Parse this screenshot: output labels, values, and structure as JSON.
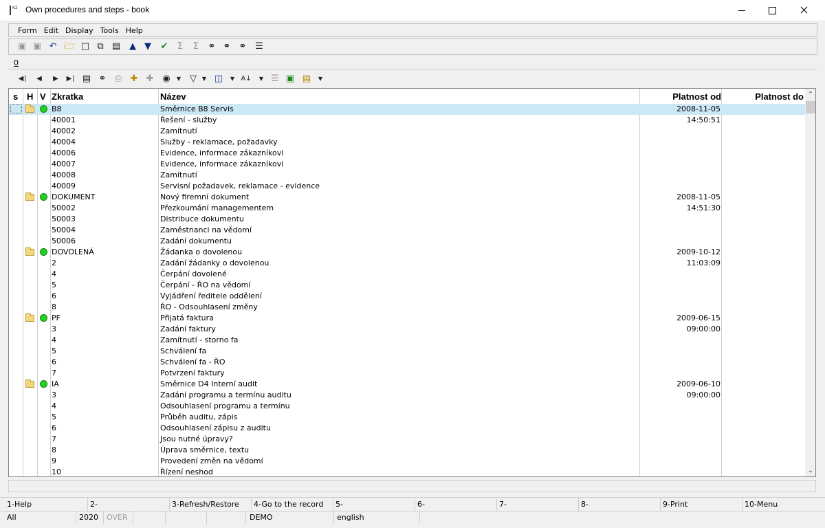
{
  "window": {
    "title": "Own procedures and steps - book",
    "app_icon_text": "K2"
  },
  "menu": [
    "Form",
    "Edit",
    "Display",
    "Tools",
    "Help"
  ],
  "tab": {
    "label": "0"
  },
  "columns": {
    "s": "s",
    "h": "H",
    "v": "V",
    "code": "Zkratka",
    "name": "Název",
    "valid_from": "Platnost od",
    "valid_to": "Platnost do"
  },
  "rows": [
    {
      "code": "B8",
      "name": "Směrnice B8 Servis",
      "from": "2008-11-05 14:50:51",
      "folder": true,
      "selected": true
    },
    {
      "code": "40001",
      "name": "Řešení - služby",
      "from": ""
    },
    {
      "code": "40002",
      "name": "Zamítnutí",
      "from": ""
    },
    {
      "code": "40004",
      "name": "Služby - reklamace, požadavky",
      "from": ""
    },
    {
      "code": "40006",
      "name": "Evidence, informace zákazníkovi",
      "from": ""
    },
    {
      "code": "40007",
      "name": "Evidence, informace zákazníkovi",
      "from": ""
    },
    {
      "code": "40008",
      "name": "Zamítnutí",
      "from": ""
    },
    {
      "code": "40009",
      "name": "Servisní požadavek, reklamace - evidence",
      "from": ""
    },
    {
      "code": "DOKUMENT",
      "name": "Nový firemní dokument",
      "from": "2008-11-05 14:51:30",
      "folder": true
    },
    {
      "code": "50002",
      "name": "Přezkoumání managementem",
      "from": ""
    },
    {
      "code": "50003",
      "name": "Distribuce dokumentu",
      "from": ""
    },
    {
      "code": "50004",
      "name": "Zaměstnanci na vědomí",
      "from": ""
    },
    {
      "code": "50006",
      "name": "Zadání dokumentu",
      "from": ""
    },
    {
      "code": "DOVOLENÁ",
      "name": "Žádanka o dovolenou",
      "from": "2009-10-12 11:03:09",
      "folder": true
    },
    {
      "code": "2",
      "name": "Zadání žádanky o dovolenou",
      "from": ""
    },
    {
      "code": "4",
      "name": "Čerpání dovolené",
      "from": ""
    },
    {
      "code": "5",
      "name": "Čerpání - ŘO na vědomí",
      "from": ""
    },
    {
      "code": "6",
      "name": "Vyjádření ředitele oddělení",
      "from": ""
    },
    {
      "code": "8",
      "name": "ŘO - Odsouhlasení změny",
      "from": ""
    },
    {
      "code": "PF",
      "name": "Přijatá faktura",
      "from": "2009-06-15 09:00:00",
      "folder": true
    },
    {
      "code": "3",
      "name": "Zadání faktury",
      "from": ""
    },
    {
      "code": "4",
      "name": "Zamítnutí - storno fa",
      "from": ""
    },
    {
      "code": "5",
      "name": "Schválení fa",
      "from": ""
    },
    {
      "code": "6",
      "name": "Schválení fa - ŘO",
      "from": ""
    },
    {
      "code": "7",
      "name": "Potvrzení faktury",
      "from": ""
    },
    {
      "code": "IA",
      "name": "Směrnice D4 Interní audit",
      "from": "2009-06-10 09:00:00",
      "folder": true
    },
    {
      "code": "3",
      "name": "Zadání programu a termínu auditu",
      "from": ""
    },
    {
      "code": "4",
      "name": "Odsouhlasení programu a termínu",
      "from": ""
    },
    {
      "code": "5",
      "name": "Průběh auditu, zápis",
      "from": ""
    },
    {
      "code": "6",
      "name": "Odsouhlasení zápisu z auditu",
      "from": ""
    },
    {
      "code": "7",
      "name": "Jsou nutné úpravy?",
      "from": ""
    },
    {
      "code": "8",
      "name": "Úprava směrnice, textu",
      "from": ""
    },
    {
      "code": "9",
      "name": "Provedení změn na vědomí",
      "from": ""
    },
    {
      "code": "10",
      "name": "Řízení neshod",
      "from": ""
    }
  ],
  "function_keys": [
    "1-Help",
    "2-",
    "3-Refresh/Restore",
    "4-Go to the record",
    "5-",
    "6-",
    "7-",
    "8-",
    "9-Print",
    "10-Menu"
  ],
  "status": {
    "scope": "All",
    "year": "2020",
    "mode": "OVER",
    "database": "DEMO",
    "language": "english"
  },
  "colors": {
    "selected_row": "#cce8f4",
    "active_dot": "#1fd41f",
    "folder": "#f4d77a"
  }
}
